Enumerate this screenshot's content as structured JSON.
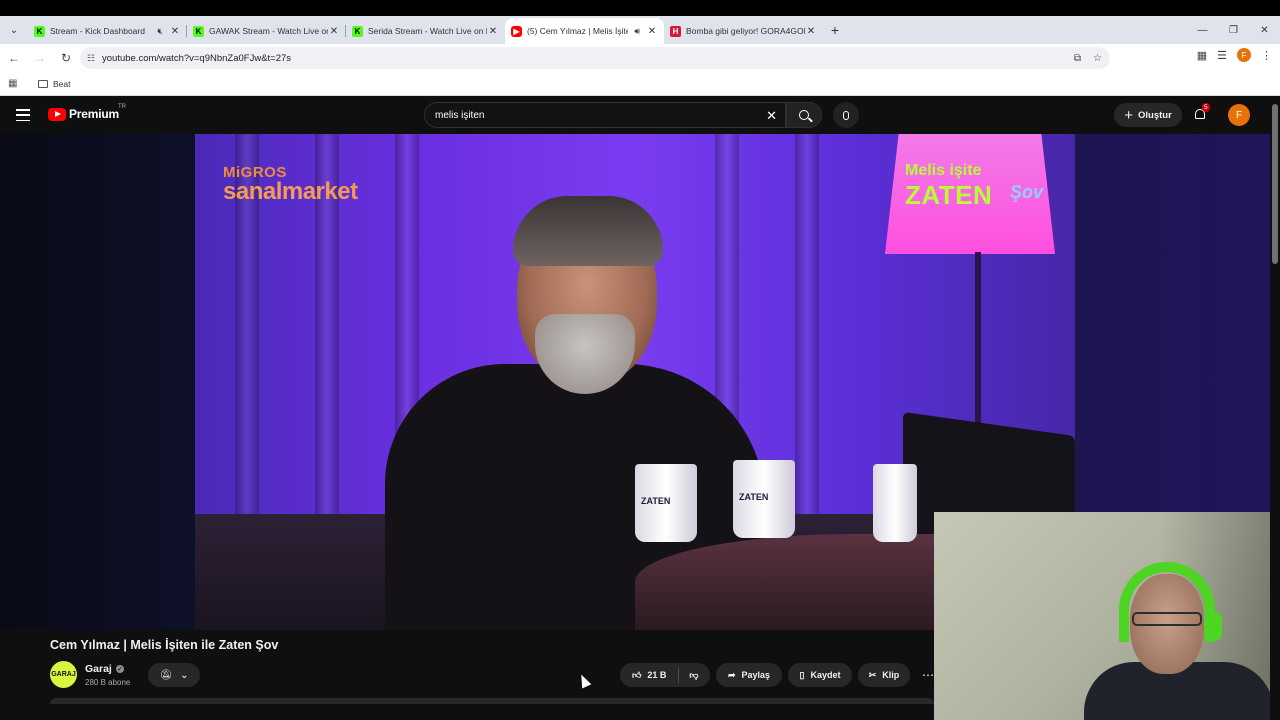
{
  "browser": {
    "tabs": [
      {
        "title": "Stream - Kick Dashboard",
        "favicon": "kick-icon",
        "audio": "muted-icon"
      },
      {
        "title": "GAWAK Stream - Watch Live on Kick",
        "favicon": "kick-icon"
      },
      {
        "title": "Serida Stream - Watch Live on Kick",
        "favicon": "kick-icon"
      },
      {
        "title": "(5) Cem Yılmaz | Melis İşiten ile Zaten Şov",
        "favicon": "youtube-icon",
        "audio": "speaker-icon",
        "active": true
      },
      {
        "title": "Bomba gibi geliyor! GORA4GORA",
        "favicon": "h-icon"
      }
    ],
    "url": "youtube.com/watch?v=q9NbnZa0FJw&t=27s",
    "bookmarks": [
      {
        "label": "Beat"
      }
    ],
    "profile_initial": "F"
  },
  "youtube": {
    "logo_text": "Premium",
    "country": "TR",
    "search_query": "melis işiten",
    "create_label": "Oluştur",
    "notification_count": "5",
    "avatar_initial": "F"
  },
  "video": {
    "sponsor_top": "MiGROS",
    "sponsor_bottom": "sanalmarket",
    "show_line1": "Melis işite",
    "show_line2": "ZATEN",
    "show_line3": "Şov",
    "mug_label": "ZATEN",
    "title": "Cem Yılmaz | Melis İşiten ile Zaten Şov",
    "channel": {
      "name": "Garaj",
      "avatar_text": "GARAJ",
      "subscribers": "280 B abone"
    },
    "likes": "21 B",
    "share_label": "Paylaş",
    "save_label": "Kaydet",
    "clip_label": "Klip"
  },
  "colors": {
    "yt_red": "#ff0000",
    "accent_green": "#b9fb36",
    "avatar_orange": "#e8710a"
  }
}
